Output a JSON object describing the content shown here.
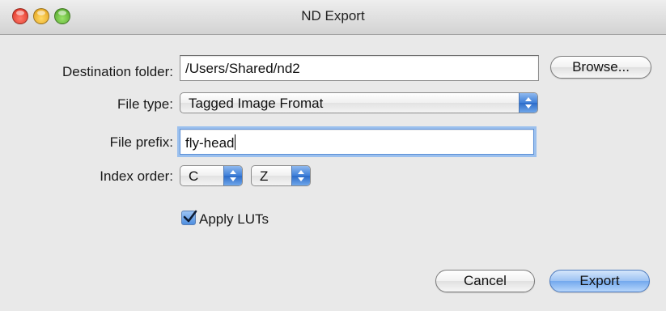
{
  "window": {
    "title": "ND Export"
  },
  "form": {
    "destination": {
      "label": "Destination folder:",
      "value": "/Users/Shared/nd2",
      "browse_label": "Browse..."
    },
    "file_type": {
      "label": "File type:",
      "value": "Tagged Image Fromat"
    },
    "file_prefix": {
      "label": "File prefix:",
      "value": "fly-head"
    },
    "index_order": {
      "label": "Index order:",
      "first": "C",
      "second": "Z"
    },
    "apply_luts": {
      "label": "Apply LUTs",
      "checked": true
    }
  },
  "buttons": {
    "cancel": "Cancel",
    "export": "Export"
  },
  "colors": {
    "accent": "#3e7fd8",
    "focus_ring": "#9bc0ee"
  }
}
